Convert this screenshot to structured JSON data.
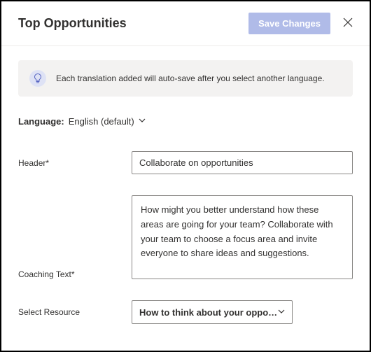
{
  "header": {
    "title": "Top Opportunities",
    "save_label": "Save Changes"
  },
  "banner": {
    "text": "Each translation added will auto-save after you select another language."
  },
  "language": {
    "label": "Language:",
    "value": "English (default)"
  },
  "fields": {
    "header_label": "Header*",
    "header_value": "Collaborate on opportunities",
    "coaching_label": "Coaching Text*",
    "coaching_value": "How might you better understand how these areas are going for your team? Collaborate with your team to choose a focus area and invite everyone to share ideas and suggestions.",
    "resource_label": "Select Resource",
    "resource_value": "How to think about your opportunit…"
  }
}
